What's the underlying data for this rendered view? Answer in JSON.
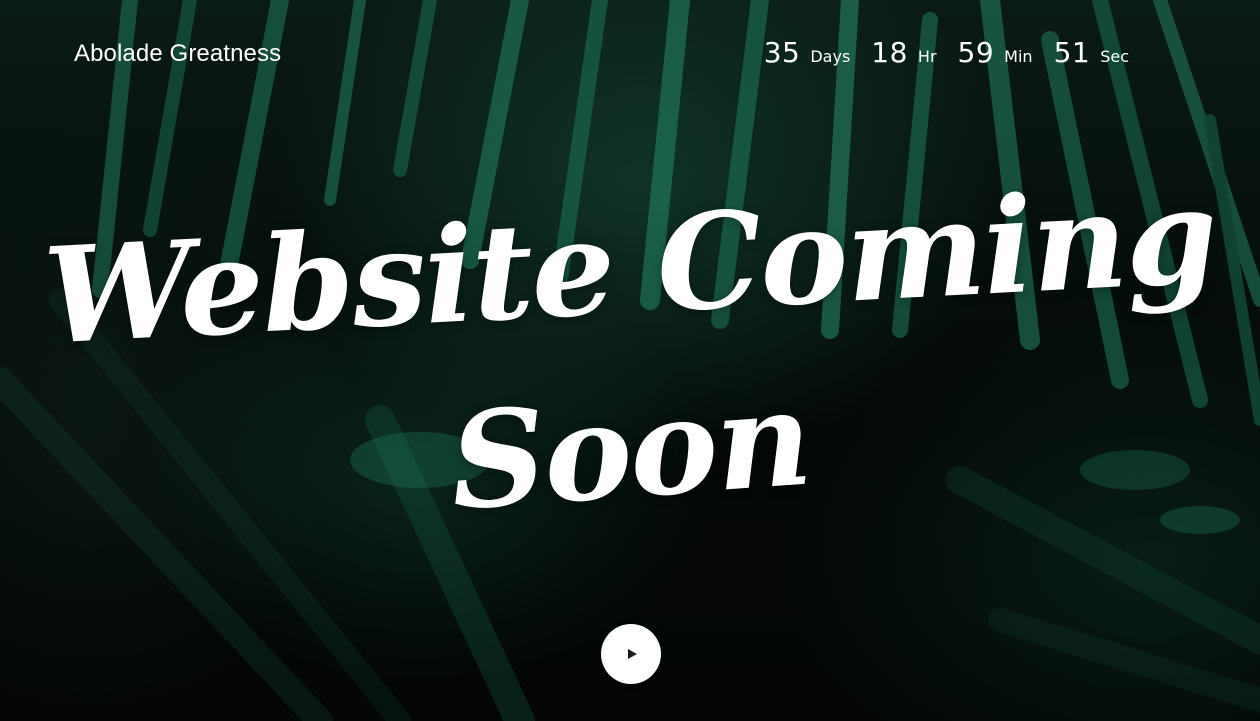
{
  "brand": {
    "name": "Abolade Greatness"
  },
  "countdown": [
    {
      "value": "35",
      "label": "Days"
    },
    {
      "value": "18",
      "label": "Hr"
    },
    {
      "value": "59",
      "label": "Min"
    },
    {
      "value": "51",
      "label": "Sec"
    }
  ],
  "hero": {
    "line1": "Website Coming",
    "line2": "Soon"
  },
  "play": {
    "icon": "play-icon"
  },
  "colors": {
    "background": "#050807",
    "foliage": "#1b6b4f",
    "text": "#ffffff"
  }
}
